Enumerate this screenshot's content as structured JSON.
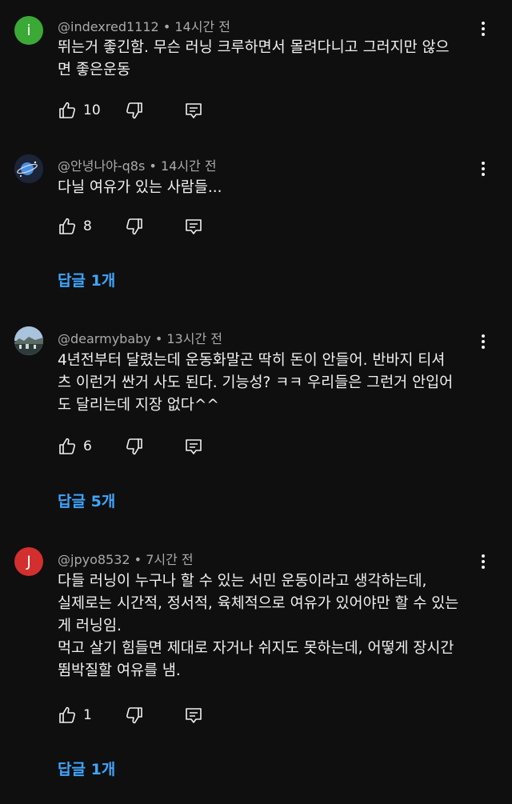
{
  "comments": [
    {
      "author": "@indexred1112",
      "time": "14시간 전",
      "avatar_letter": "i",
      "avatar_color": "#3aa935",
      "lines": [
        "뛰는거 좋긴함. 무슨 러닝 크루하면서 몰려다니고 그러지만 않으",
        "면 좋은운동"
      ],
      "likes": "10"
    },
    {
      "author": "@안녕나야-q8s",
      "time": "14시간 전",
      "avatar_letter": "",
      "avatar_color": "#2a3550",
      "lines": [
        "다닐 여유가 있는 사람들..."
      ],
      "likes": "8",
      "replies": "답글 1개"
    },
    {
      "author": "@dearmybaby",
      "time": "13시간 전",
      "avatar_letter": "",
      "avatar_color": "#7fa3c8",
      "lines": [
        "4년전부터 달렸는데 운동화말곤 딱히 돈이 안들어. 반바지 티셔",
        "츠 이런거 싼거 사도 된다. 기능성? ㅋㅋ 우리들은 그런거 안입어",
        "도 달리는데 지장 없다^^"
      ],
      "likes": "6",
      "replies": "답글 5개"
    },
    {
      "author": "@jpyo8532",
      "time": "7시간 전",
      "avatar_letter": "J",
      "avatar_color": "#d32f2f",
      "lines": [
        "다들 러닝이 누구나 할 수 있는 서민 운동이라고 생각하는데,",
        "실제로는 시간적, 정서적, 육체적으로 여유가 있어야만 할 수 있는",
        "게 러닝임.",
        "먹고 살기 힘들면 제대로 자거나 쉬지도 못하는데, 어떻게 장시간",
        "뜀박질할 여유를 냄."
      ],
      "likes": "1",
      "replies": "답글 1개"
    }
  ]
}
